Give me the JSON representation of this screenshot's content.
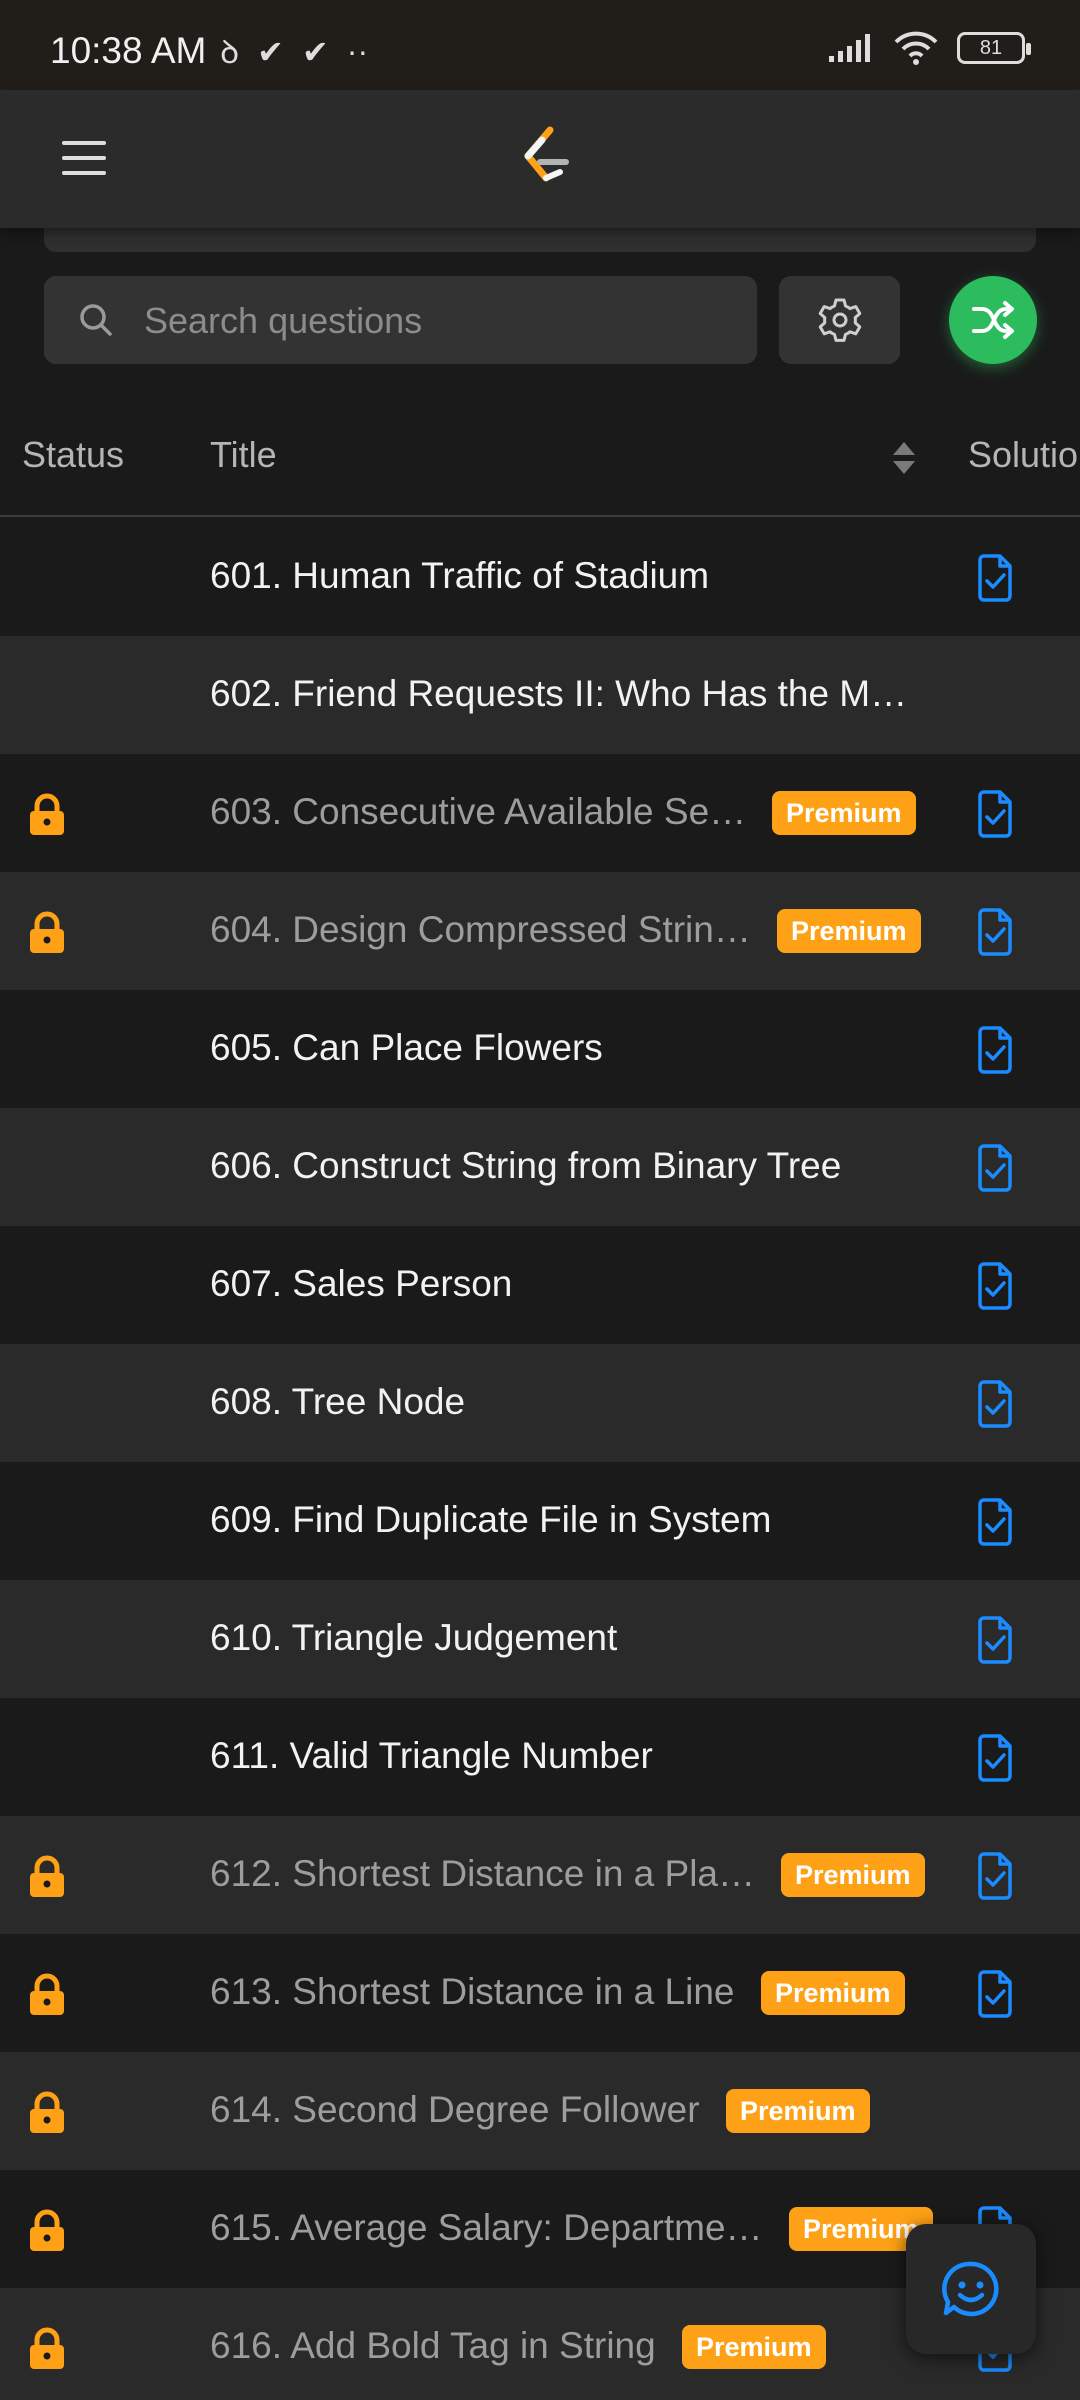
{
  "status_bar": {
    "time": "10:38 AM",
    "battery": "81"
  },
  "search": {
    "placeholder": "Search questions"
  },
  "table": {
    "headers": {
      "status": "Status",
      "title": "Title",
      "solution": "Solutio"
    },
    "rows": [
      {
        "title": "601. Human Traffic of Stadium",
        "locked": false,
        "premium": false,
        "solution": true
      },
      {
        "title": "602. Friend Requests II: Who Has the M…",
        "locked": false,
        "premium": false,
        "solution": false
      },
      {
        "title": "603. Consecutive Available Se…",
        "locked": true,
        "premium": true,
        "solution": true
      },
      {
        "title": "604. Design Compressed Strin…",
        "locked": true,
        "premium": true,
        "solution": true
      },
      {
        "title": "605. Can Place Flowers",
        "locked": false,
        "premium": false,
        "solution": true
      },
      {
        "title": "606. Construct String from Binary Tree",
        "locked": false,
        "premium": false,
        "solution": true
      },
      {
        "title": "607. Sales Person",
        "locked": false,
        "premium": false,
        "solution": true
      },
      {
        "title": "608. Tree Node",
        "locked": false,
        "premium": false,
        "solution": true
      },
      {
        "title": "609. Find Duplicate File in System",
        "locked": false,
        "premium": false,
        "solution": true
      },
      {
        "title": "610. Triangle Judgement",
        "locked": false,
        "premium": false,
        "solution": true
      },
      {
        "title": "611. Valid Triangle Number",
        "locked": false,
        "premium": false,
        "solution": true
      },
      {
        "title": "612. Shortest Distance in a Pla…",
        "locked": true,
        "premium": true,
        "solution": true
      },
      {
        "title": "613. Shortest Distance in a Line",
        "locked": true,
        "premium": true,
        "solution": true
      },
      {
        "title": "614. Second Degree Follower",
        "locked": true,
        "premium": true,
        "solution": false
      },
      {
        "title": "615. Average Salary: Departme…",
        "locked": true,
        "premium": true,
        "solution": true
      },
      {
        "title": "616. Add Bold Tag in String",
        "locked": true,
        "premium": true,
        "solution": true
      }
    ],
    "premium_label": "Premium"
  },
  "colors": {
    "accent_orange": "#ffa116",
    "accent_green": "#2cbb5d",
    "solution_blue": "#1a8cff"
  },
  "icons": [
    "menu-icon",
    "leetcode-logo",
    "search-icon",
    "gear-icon",
    "shuffle-icon",
    "sort-icon",
    "lock-icon",
    "solution-doc-icon",
    "chat-smile-icon"
  ]
}
